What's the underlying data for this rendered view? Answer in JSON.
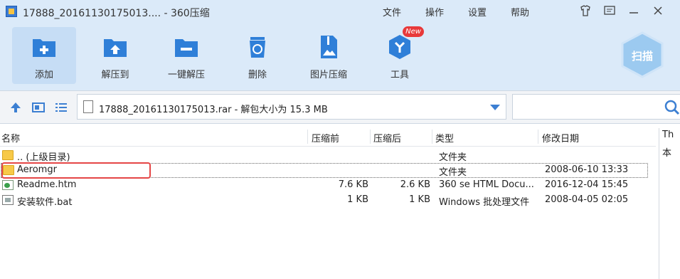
{
  "window": {
    "title": "17888_20161130175013.... - 360压缩",
    "menu": [
      "文件",
      "操作",
      "设置",
      "帮助"
    ],
    "controls": [
      "skin-icon",
      "feedback-icon",
      "minimize-icon",
      "close-icon"
    ]
  },
  "toolbar": {
    "items": [
      {
        "label": "添加",
        "icon": "add-folder-icon"
      },
      {
        "label": "解压到",
        "icon": "extract-to-icon"
      },
      {
        "label": "一键解压",
        "icon": "one-click-extract-icon"
      },
      {
        "label": "删除",
        "icon": "recycle-bin-icon"
      },
      {
        "label": "图片压缩",
        "icon": "image-compress-icon"
      },
      {
        "label": "工具",
        "icon": "tools-icon"
      }
    ],
    "new_badge": "New",
    "scan_label": "扫描"
  },
  "address": {
    "path_text": "17888_20161130175013.rar - 解包大小为 15.3 MB"
  },
  "search": {
    "placeholder": ""
  },
  "list": {
    "columns": [
      "名称",
      "压缩前",
      "压缩后",
      "类型",
      "修改日期"
    ],
    "rows": [
      {
        "name": ".. (上级目录)",
        "before": "",
        "after": "",
        "type": "文件夹",
        "date": "",
        "icon": "parent-folder-icon"
      },
      {
        "name": "Aeromgr",
        "before": "",
        "after": "",
        "type": "文件夹",
        "date": "2008-06-10 13:33",
        "icon": "folder-icon"
      },
      {
        "name": "Readme.htm",
        "before": "7.6 KB",
        "after": "2.6 KB",
        "type": "360 se HTML Docu...",
        "date": "2016-12-04 15:45",
        "icon": "html-file-icon"
      },
      {
        "name": "安装软件.bat",
        "before": "1 KB",
        "after": "1 KB",
        "type": "Windows 批处理文件",
        "date": "2008-04-05 02:05",
        "icon": "bat-file-icon"
      }
    ]
  },
  "right_pane": {
    "line1": "Th",
    "line2": "本"
  },
  "colors": {
    "toolbar_bg": "#dbeaf9",
    "accent": "#3c7fd2",
    "highlight": "#e54646"
  }
}
